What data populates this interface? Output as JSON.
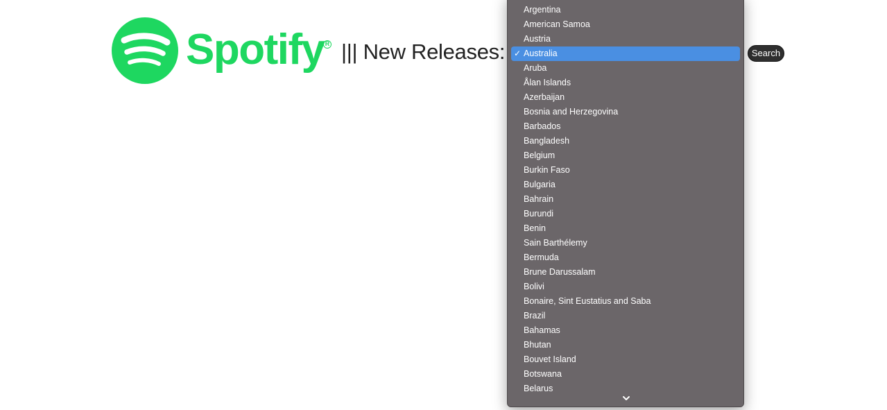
{
  "header": {
    "logo_word": "Spotify",
    "heading": "||| New Releases:",
    "search_label": "Search"
  },
  "colors": {
    "brand_green": "#1ed760",
    "dropdown_bg": "#6b6669",
    "selected_bg": "#4a8fe2",
    "button_bg": "#2f2f2f"
  },
  "country_select": {
    "selected": "Australia",
    "options": [
      "Argentina",
      "American Samoa",
      "Austria",
      "Australia",
      "Aruba",
      "Ålan Islands",
      "Azerbaijan",
      "Bosnia and Herzegovina",
      "Barbados",
      "Bangladesh",
      "Belgium",
      "Burkin Faso",
      "Bulgaria",
      "Bahrain",
      "Burundi",
      "Benin",
      "Sain Barthélemy",
      "Bermuda",
      "Brune Darussalam",
      "Bolivi",
      "Bonaire, Sint Eustatius and Saba",
      "Brazil",
      "Bahamas",
      "Bhutan",
      "Bouvet Island",
      "Botswana",
      "Belarus"
    ],
    "check_icon": "checkmark-icon",
    "scroll_icon": "chevron-down-icon"
  }
}
